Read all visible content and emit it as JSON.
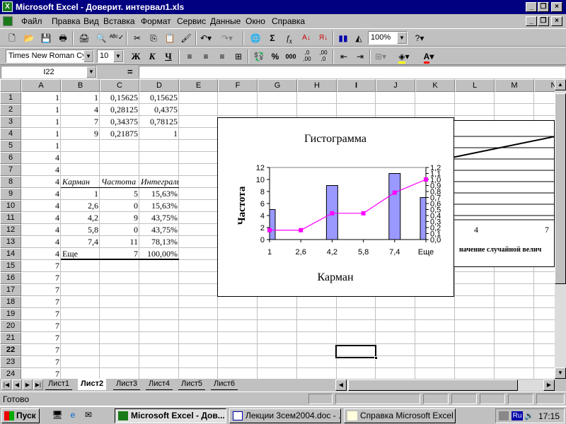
{
  "window": {
    "title": "Microsoft Excel - Доверит. интервал1.xls"
  },
  "menu": [
    {
      "label": "Файл"
    },
    {
      "label": "Правка"
    },
    {
      "label": "Вид"
    },
    {
      "label": "Вставка"
    },
    {
      "label": "Формат"
    },
    {
      "label": "Сервис"
    },
    {
      "label": "Данные"
    },
    {
      "label": "Окно"
    },
    {
      "label": "Справка"
    }
  ],
  "toolbar_standard": {
    "zoom": "100%"
  },
  "toolbar_format": {
    "font": "Times New Roman Cyr",
    "size": "10",
    "bold": "Ж",
    "italic": "К",
    "underline": "Ч",
    "percent": "%",
    "thousands": "000",
    "inc_decimal": ",0\n,00",
    "dec_decimal": ",00\n,0"
  },
  "formula_bar": {
    "name_box": "I22",
    "equals": "=",
    "value": ""
  },
  "columns": [
    "A",
    "B",
    "C",
    "D",
    "E",
    "F",
    "G",
    "H",
    "I",
    "J",
    "K",
    "L",
    "M",
    "N"
  ],
  "rows": [
    "1",
    "2",
    "3",
    "4",
    "5",
    "6",
    "7",
    "8",
    "9",
    "10",
    "11",
    "12",
    "13",
    "14",
    "15",
    "16",
    "17",
    "18",
    "19",
    "20",
    "21",
    "22",
    "23",
    "24"
  ],
  "cells": {
    "A": [
      "1",
      "1",
      "1",
      "1",
      "1",
      "4",
      "4",
      "4",
      "4",
      "4",
      "4",
      "4",
      "4",
      "4",
      "7",
      "7",
      "7",
      "7",
      "7",
      "7",
      "7",
      "7",
      "7",
      "7"
    ],
    "B": [
      "1",
      "4",
      "7",
      "9"
    ],
    "C": [
      "0,15625",
      "0,28125",
      "0,34375",
      "0,21875"
    ],
    "D": [
      "0,15625",
      "0,4375",
      "0,78125",
      "1"
    ]
  },
  "freq_table": {
    "headers": [
      "Карман",
      "Частота",
      "Интегральный %"
    ],
    "rows": [
      [
        "1",
        "5",
        "15,63%"
      ],
      [
        "2,6",
        "0",
        "15,63%"
      ],
      [
        "4,2",
        "9",
        "43,75%"
      ],
      [
        "5,8",
        "0",
        "43,75%"
      ],
      [
        "7,4",
        "11",
        "78,13%"
      ],
      [
        "Еще",
        "7",
        "100,00%"
      ]
    ]
  },
  "chart_data": [
    {
      "type": "bar",
      "title": "Гистограмма",
      "xlabel": "Карман",
      "ylabel": "Частота",
      "categories": [
        "1",
        "2,6",
        "4,2",
        "5,8",
        "7,4",
        "Еще"
      ],
      "series": [
        {
          "values": [
            5,
            0,
            9,
            0,
            11,
            7
          ],
          "color": "#9999ff"
        },
        {
          "type": "line",
          "axis": "secondary",
          "values": [
            0.1563,
            0.1563,
            0.4375,
            0.4375,
            0.7813,
            1.0
          ],
          "color": "#ff00ff"
        }
      ],
      "y_ticks": [
        "0",
        "2",
        "4",
        "6",
        "8",
        "10",
        "12"
      ],
      "ylim": [
        0,
        12
      ],
      "y2_ticks": [
        "0,0",
        "0,1",
        "0,2",
        "0,3",
        "0,4",
        "0,5",
        "0,6",
        "0,7",
        "0,8",
        "0,9",
        "1,0",
        "1,1",
        "1,2"
      ],
      "y2lim": [
        0,
        1.2
      ]
    },
    {
      "type": "line",
      "x_ticks": [
        "4",
        "7"
      ],
      "xlabel_partial": "начение случайной велич",
      "series": [
        {
          "values": [
            0.75,
            1.0
          ],
          "color": "#000000"
        }
      ]
    }
  ],
  "sheets": [
    "Лист1",
    "Лист2",
    "Лист3",
    "Лист4",
    "Лист5",
    "Лист6"
  ],
  "active_sheet": "Лист2",
  "status": {
    "text": "Готово"
  },
  "taskbar": {
    "start": "Пуск",
    "buttons": [
      "Microsoft Excel - Дов...",
      "Лекции 3сем2004.doc - ...",
      "Справка Microsoft Excel"
    ],
    "lang": "Ru",
    "time": "17:15"
  }
}
